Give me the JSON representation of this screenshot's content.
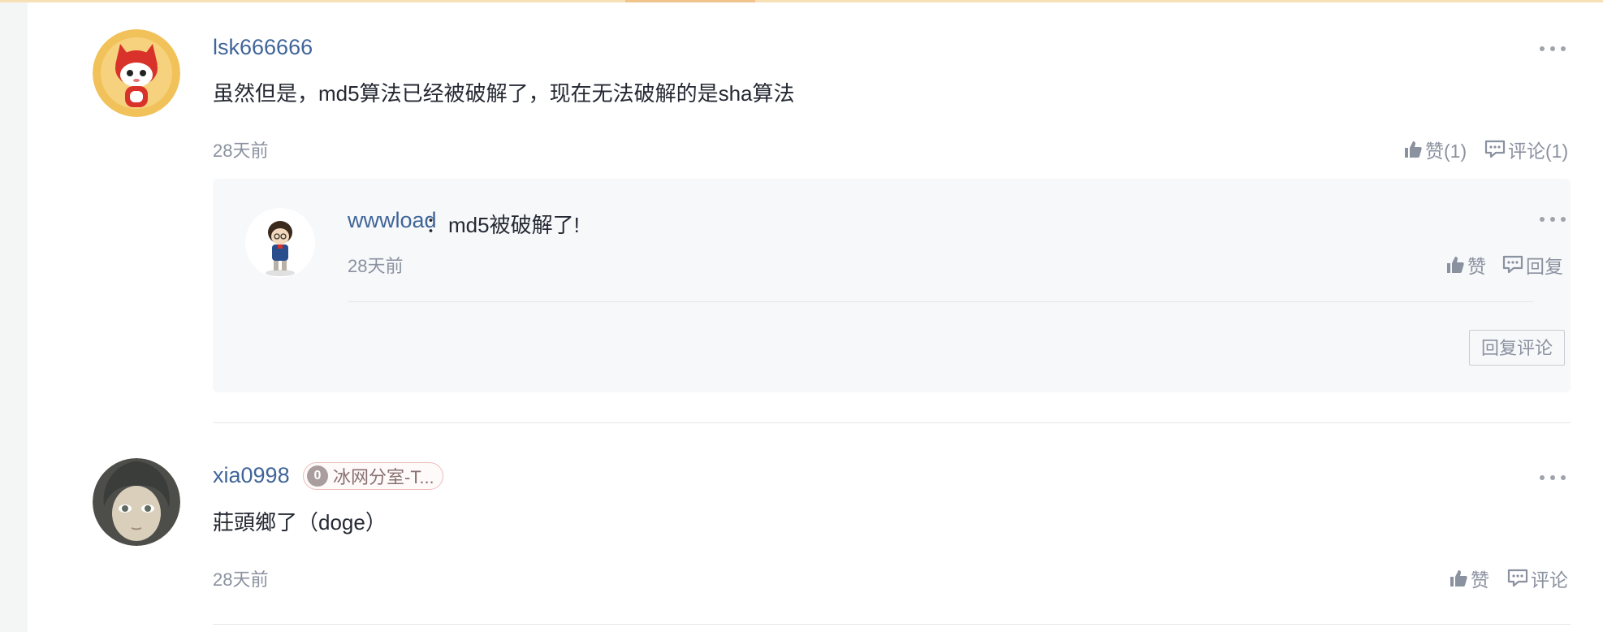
{
  "comments": [
    {
      "username": "lsk666666",
      "text": "虽然但是，md5算法已经被破解了，现在无法破解的是sha算法",
      "time": "28天前",
      "like_label": "赞(1)",
      "comment_label": "评论(1)",
      "replies": [
        {
          "username": "wwwload",
          "separator": "：",
          "text": "md5被破解了!",
          "time": "28天前",
          "like_label": "赞",
          "reply_label": "回复"
        }
      ],
      "reply_comment_button": "回复评论"
    },
    {
      "username": "xia0998",
      "badge_level": "0",
      "badge_text": "冰网分室-T...",
      "text": "莊頭鄉了（doge）",
      "time": "28天前",
      "like_label": "赞",
      "comment_label": "评论"
    }
  ],
  "colors": {
    "username": "#406599",
    "text": "#252933",
    "muted": "#8a919f",
    "reply_bg": "#f7f8fa"
  },
  "icons": [
    "like-icon",
    "comment-icon",
    "more-icon",
    "avatar-icon"
  ]
}
